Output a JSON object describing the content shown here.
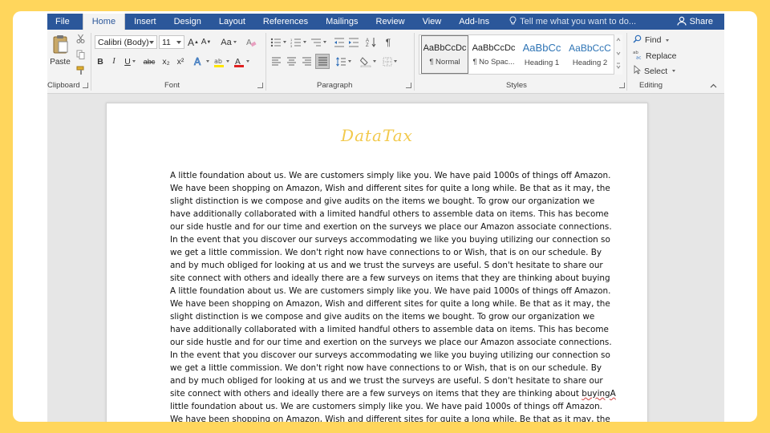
{
  "tabs": [
    "File",
    "Home",
    "Insert",
    "Design",
    "Layout",
    "References",
    "Mailings",
    "Review",
    "View",
    "Add-Ins"
  ],
  "active_tab": "Home",
  "tell_me_placeholder": "Tell me what you want to do...",
  "share_label": "Share",
  "clipboard": {
    "paste_label": "Paste",
    "group_label": "Clipboard"
  },
  "font": {
    "family": "Calibri (Body)",
    "size": "11",
    "group_label": "Font",
    "bold": "B",
    "italic": "I",
    "underline": "U",
    "strike": "abc",
    "subscript": "x₂",
    "superscript": "x²",
    "grow": "A",
    "shrink": "A",
    "case": "Aa"
  },
  "paragraph": {
    "group_label": "Paragraph"
  },
  "styles": {
    "group_label": "Styles",
    "items": [
      {
        "preview": "AaBbCcDc",
        "name": "¶ Normal"
      },
      {
        "preview": "AaBbCcDc",
        "name": "¶ No Spac..."
      },
      {
        "preview": "AaBbCc",
        "name": "Heading 1"
      },
      {
        "preview": "AaBbCcC",
        "name": "Heading 2"
      }
    ]
  },
  "editing": {
    "group_label": "Editing",
    "find": "Find",
    "replace": "Replace",
    "select": "Select"
  },
  "document": {
    "watermark": "DataTax",
    "lines": [
      "A little foundation about us. We are customers simply like you. We have paid 1000s of things off Amazon.",
      "We have been shopping on Amazon, Wish and different sites for quite a long while. Be that as it may, the",
      "slight distinction is we compose and give audits on the items we bought. To grow our organization   we",
      "have additionally collaborated with a limited   handful others to assemble data on items. This has become",
      "our side hustle and for our time and exertion on the surveys we place our Amazon associate connections.",
      "In the event that you discover our surveys accommodating we like you buying utilizing our connection so",
      "we get a little commission. We don't right now have connections to or Wish, that is on our schedule. By",
      "and by much obliged for looking at us and we trust the surveys are useful. S don't hesitate to share our",
      "site connect with others and ideally there are a few surveys on items that they are thinking about buying",
      "A little foundation about us. We are customers simply like you. We have paid 1000s of things off Amazon.",
      "We have been shopping on Amazon, Wish and different sites for quite a long while. Be that as it may, the",
      "slight distinction is we compose and give audits on the items we bought. To grow our organization   we",
      "have additionally collaborated with a limited   handful others to assemble data on items. This has become",
      "our side hustle and for our time and exertion on the surveys we place our Amazon associate connections.",
      "In the event that you discover our surveys accommodating we like you buying utilizing our connection so",
      "we get a little commission. We don't right now have connections to or Wish, that is on our schedule. By",
      "and by much obliged for looking at us and we trust the surveys are useful. S don't hesitate to share our",
      "site connect with others and ideally there are a few surveys on items that they are thinking about",
      "little foundation about us. We are customers simply like you. We have paid 1000s of things off Amazon.",
      "We have been shopping on Amazon, Wish and different sites for quite a long while. Be that as it may, the"
    ],
    "misspelled_word": "buyingA"
  }
}
